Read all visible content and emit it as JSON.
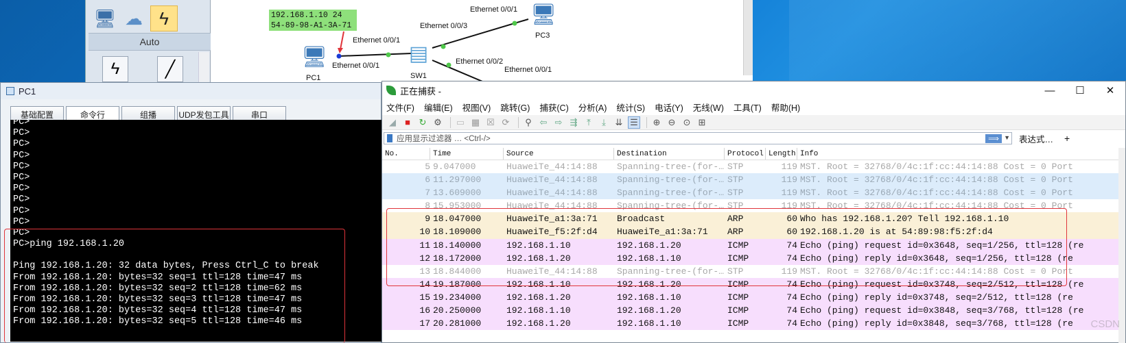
{
  "topology": {
    "panel": {
      "auto_label": "Auto",
      "icons": [
        "pc-monitor-icon",
        "cloud-icon",
        "lightning-icon"
      ]
    },
    "ip_annotation": [
      "192.168.1.10 24",
      "54-89-98-A1-3A-71"
    ],
    "labels": {
      "pc1_port": "Ethernet 0/0/1",
      "sw1_port1": "Ethernet 0/0/1",
      "sw1_port3": "Ethernet 0/0/3",
      "sw1_port2": "Ethernet 0/0/2",
      "pc3_port": "Ethernet 0/0/1",
      "lower_port": "Ethernet 0/0/1",
      "pc1": "PC1",
      "sw1": "SW1",
      "pc3": "PC3"
    }
  },
  "pc1": {
    "title": "PC1",
    "tabs": [
      "基础配置",
      "命令行",
      "组播",
      "UDP发包工具",
      "串口"
    ],
    "console_lines": [
      "PC>",
      "PC>",
      "PC>",
      "PC>",
      "PC>",
      "PC>",
      "PC>",
      "PC>",
      "PC>",
      "PC>",
      "PC>",
      "PC>ping 192.168.1.20",
      "",
      "Ping 192.168.1.20: 32 data bytes, Press Ctrl_C to break",
      "From 192.168.1.20: bytes=32 seq=1 ttl=128 time=47 ms",
      "From 192.168.1.20: bytes=32 seq=2 ttl=128 time=62 ms",
      "From 192.168.1.20: bytes=32 seq=3 ttl=128 time=47 ms",
      "From 192.168.1.20: bytes=32 seq=4 ttl=128 time=47 ms",
      "From 192.168.1.20: bytes=32 seq=5 ttl=128 time=46 ms"
    ]
  },
  "wireshark": {
    "title": "正在捕获 -",
    "window_buttons": [
      "—",
      "☐",
      "✕"
    ],
    "menu": [
      "文件(F)",
      "编辑(E)",
      "视图(V)",
      "跳转(G)",
      "捕获(C)",
      "分析(A)",
      "统计(S)",
      "电话(Y)",
      "无线(W)",
      "工具(T)",
      "帮助(H)"
    ],
    "filter_placeholder": "应用显示过滤器 … <Ctrl-/>",
    "filter_arrow": "⟹",
    "expression_label": "表达式…",
    "plus_label": "+",
    "columns": [
      "No.",
      "Time",
      "Source",
      "Destination",
      "Protocol",
      "Length",
      "Info"
    ],
    "packets": [
      {
        "no": "5",
        "time": "9.047000",
        "src": "HuaweiTe_44:14:88",
        "dst": "Spanning-tree-(for-…",
        "proto": "STP",
        "len": "119",
        "info": "MST. Root = 32768/0/4c:1f:cc:44:14:88   Cost = 0   Port",
        "kind": "stp"
      },
      {
        "no": "6",
        "time": "11.297000",
        "src": "HuaweiTe_44:14:88",
        "dst": "Spanning-tree-(for-…",
        "proto": "STP",
        "len": "119",
        "info": "MST. Root = 32768/0/4c:1f:cc:44:14:88   Cost = 0   Port",
        "kind": "stp-blue"
      },
      {
        "no": "7",
        "time": "13.609000",
        "src": "HuaweiTe_44:14:88",
        "dst": "Spanning-tree-(for-…",
        "proto": "STP",
        "len": "119",
        "info": "MST. Root = 32768/0/4c:1f:cc:44:14:88   Cost = 0   Port",
        "kind": "stp-blue"
      },
      {
        "no": "8",
        "time": "15.953000",
        "src": "HuaweiTe_44:14:88",
        "dst": "Spanning-tree-(for-…",
        "proto": "STP",
        "len": "119",
        "info": "MST. Root = 32768/0/4c:1f:cc:44:14:88   Cost = 0   Port",
        "kind": "stp"
      },
      {
        "no": "9",
        "time": "18.047000",
        "src": "HuaweiTe_a1:3a:71",
        "dst": "Broadcast",
        "proto": "ARP",
        "len": "60",
        "info": "Who has 192.168.1.20? Tell 192.168.1.10",
        "kind": "arp"
      },
      {
        "no": "10",
        "time": "18.109000",
        "src": "HuaweiTe_f5:2f:d4",
        "dst": "HuaweiTe_a1:3a:71",
        "proto": "ARP",
        "len": "60",
        "info": "192.168.1.20 is at 54:89:98:f5:2f:d4",
        "kind": "arp"
      },
      {
        "no": "11",
        "time": "18.140000",
        "src": "192.168.1.10",
        "dst": "192.168.1.20",
        "proto": "ICMP",
        "len": "74",
        "info": "Echo (ping) request  id=0x3648, seq=1/256, ttl=128 (re",
        "kind": "icmp"
      },
      {
        "no": "12",
        "time": "18.172000",
        "src": "192.168.1.20",
        "dst": "192.168.1.10",
        "proto": "ICMP",
        "len": "74",
        "info": "Echo (ping) reply    id=0x3648, seq=1/256, ttl=128 (re",
        "kind": "icmp"
      },
      {
        "no": "13",
        "time": "18.844000",
        "src": "HuaweiTe_44:14:88",
        "dst": "Spanning-tree-(for-…",
        "proto": "STP",
        "len": "119",
        "info": "MST. Root = 32768/0/4c:1f:cc:44:14:88   Cost = 0   Port",
        "kind": "stp"
      },
      {
        "no": "14",
        "time": "19.187000",
        "src": "192.168.1.10",
        "dst": "192.168.1.20",
        "proto": "ICMP",
        "len": "74",
        "info": "Echo (ping) request  id=0x3748, seq=2/512, ttl=128 (re",
        "kind": "icmp"
      },
      {
        "no": "15",
        "time": "19.234000",
        "src": "192.168.1.20",
        "dst": "192.168.1.10",
        "proto": "ICMP",
        "len": "74",
        "info": "Echo (ping) reply    id=0x3748, seq=2/512, ttl=128 (re",
        "kind": "icmp"
      },
      {
        "no": "16",
        "time": "20.250000",
        "src": "192.168.1.10",
        "dst": "192.168.1.20",
        "proto": "ICMP",
        "len": "74",
        "info": "Echo (ping) request  id=0x3848, seq=3/768, ttl=128 (re",
        "kind": "icmp"
      },
      {
        "no": "17",
        "time": "20.281000",
        "src": "192.168.1.20",
        "dst": "192.168.1.10",
        "proto": "ICMP",
        "len": "74",
        "info": "Echo (ping) reply    id=0x3848, seq=3/768, ttl=128 (re",
        "kind": "icmp"
      }
    ],
    "colors": {
      "arp": "#faf0d7",
      "icmp": "#f7defd",
      "stp_highlight": "#dcecfb",
      "annotation_red": "#e0343a"
    }
  }
}
